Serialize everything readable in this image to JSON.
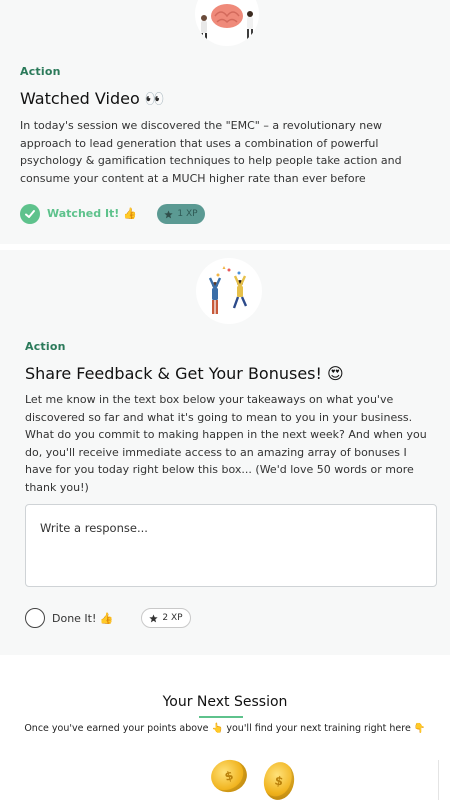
{
  "action1": {
    "label": "Action",
    "title": "Watched Video 👀",
    "body": "In today's session we discovered the \"EMC\" – a revolutionary new approach to lead generation that uses a combination of powerful psychology & gamification techniques to help people take action and consume your content at a MUCH higher rate than ever before",
    "status_label": "Watched It! 👍",
    "xp": "1 XP",
    "completed": true,
    "icons": [
      "brain-illustration-icon",
      "checkmark-icon",
      "star-icon"
    ]
  },
  "action2": {
    "label": "Action",
    "title": "Share Feedback & Get Your Bonuses! 😍",
    "body": "Let me know in the text box below your takeaways on what you've discovered so far and what it's going to mean to you in your business. What do you commit to making happen in the next week? And when you do, you'll receive immediate access to an amazing array of bonuses I have for you today right below this box... (We'd love 50 words or more thank you!)",
    "response_placeholder": "Write a response...",
    "status_label": "Done It! 👍",
    "xp": "2 XP",
    "completed": false,
    "icons": [
      "celebrating-people-illustration-icon",
      "star-icon"
    ]
  },
  "next_session": {
    "title": "Your Next Session",
    "subtitle": "Once you've earned your points above 👆 you'll find your next training right here 👇",
    "icons": [
      "gold-coin-icon",
      "gold-coin-icon"
    ]
  },
  "colors": {
    "accent_green": "#5ec28c",
    "action_green": "#2b7a5a",
    "xp_teal": "#5b9a93",
    "card_bg": "#f7f8f8"
  }
}
